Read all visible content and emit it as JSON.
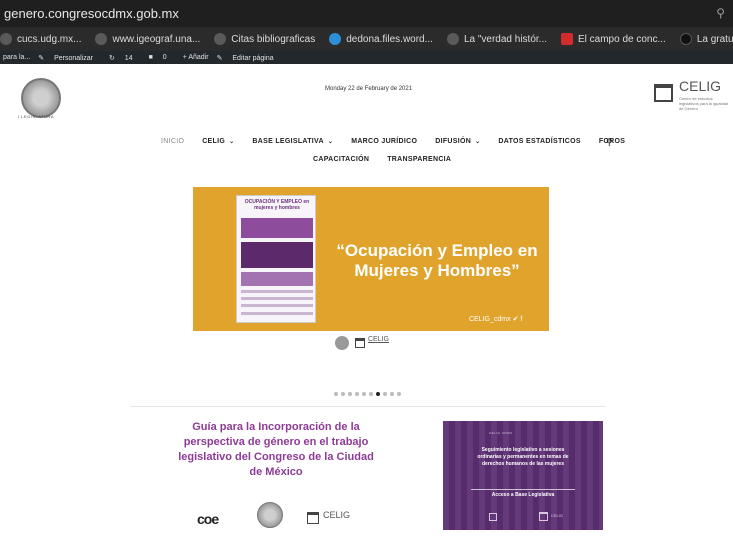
{
  "browser": {
    "url": "genero.congresocdmx.gob.mx",
    "search_icon": "search-icon",
    "bookmarks": [
      {
        "label": "cucs.udg.mx...",
        "icon": "globe-icon"
      },
      {
        "label": "www.igeograf.una...",
        "icon": "globe-icon"
      },
      {
        "label": "Citas bibliograficas",
        "icon": "globe-icon"
      },
      {
        "label": "dedona.files.word...",
        "icon": "wordpress-icon"
      },
      {
        "label": "La \"verdad histór...",
        "icon": "globe-icon"
      },
      {
        "label": "El campo de conc...",
        "icon": "red-a-icon"
      },
      {
        "label": "La gratuidad del c...",
        "icon": "dark-icon"
      }
    ]
  },
  "admin_bar": {
    "items": [
      "para la...",
      "Personalizar",
      "14",
      "0",
      "+ Añadir",
      "Editar página"
    ]
  },
  "header": {
    "seal_caption": "I LEGISLATURA",
    "date": "Monday 22 de February de 2021",
    "celig_name": "CELIG",
    "celig_sub": "Centro de estudios legislativos para la igualdad de Género"
  },
  "nav": {
    "row1": [
      {
        "label": "INICIO",
        "dropdown": false,
        "active": true
      },
      {
        "label": "CELIG",
        "dropdown": true,
        "active": false
      },
      {
        "label": "BASE LEGISLATIVA",
        "dropdown": true,
        "active": false
      },
      {
        "label": "MARCO JURÍDICO",
        "dropdown": false,
        "active": false
      },
      {
        "label": "DIFUSIÓN",
        "dropdown": true,
        "active": false
      },
      {
        "label": "DATOS ESTADÍSTICOS",
        "dropdown": false,
        "active": false
      },
      {
        "label": "FOROS",
        "dropdown": false,
        "active": false
      }
    ],
    "row2": [
      {
        "label": "CAPACITACIÓN"
      },
      {
        "label": "TRANSPARENCIA"
      }
    ],
    "search_icon": "search-icon"
  },
  "banner": {
    "poster_title": "OCUPACIÓN Y EMPLEO en mujeres y hombres",
    "title": "“Ocupación y Empleo en Mujeres y Hombres”",
    "handle": "CELIG_cdmx",
    "social_icons": "twitter-icon facebook-icon",
    "color": "#e0a42c"
  },
  "below_logos": {
    "celig_name": "CELIG"
  },
  "carousel": {
    "total": 10,
    "active_index": 6
  },
  "guide_card": {
    "title": "Guía para la Incorporación de la perspectiva de género en el trabajo legislativo del Congreso de la Ciudad de México",
    "coe": "coe",
    "celig_name": "CELIG",
    "title_color": "#8e3b97"
  },
  "purple_card": {
    "header": "CELIG CDMX",
    "text": "Seguimiento legislativo a sesiones ordinarias y permanentes en temas de derechos humanos de las mujeres",
    "link": "Acceso a Base Legislativa",
    "celig_name": "CELIG",
    "color": "#5c2f73"
  }
}
